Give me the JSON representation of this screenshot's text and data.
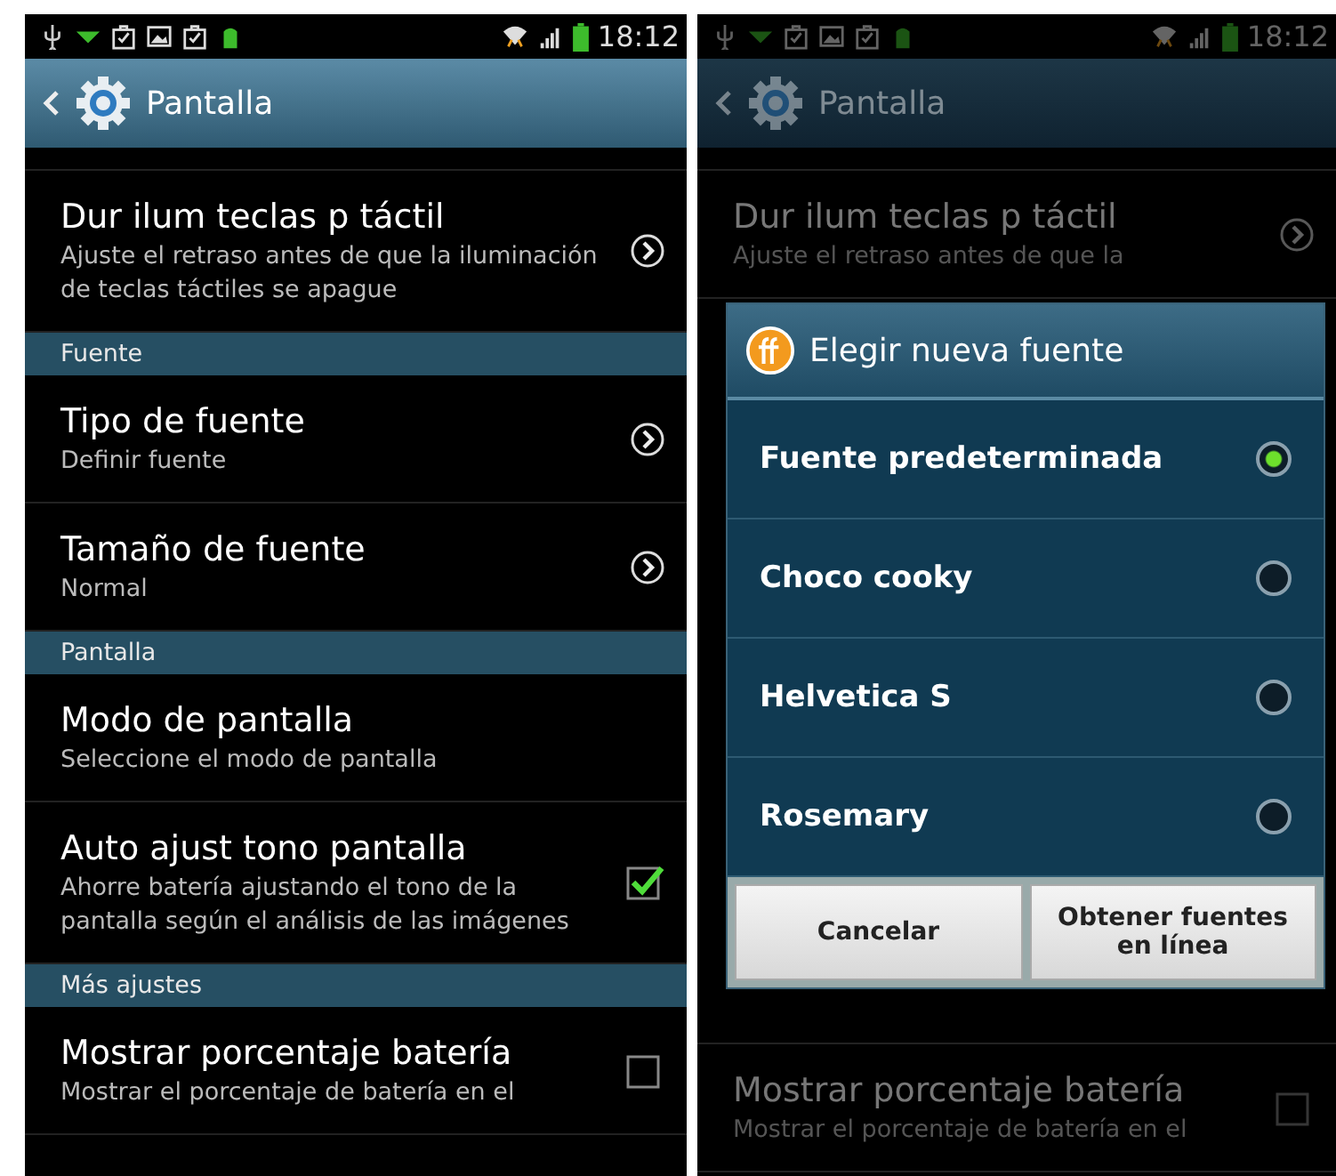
{
  "screens": [
    {
      "dimmed": false,
      "status_bar": {
        "time": "18:12"
      },
      "header": {
        "title": "Pantalla"
      },
      "items_above": [
        {
          "kind": "chevron",
          "title": "Dur ilum teclas p táctil",
          "subtitle": "Ajuste el retraso antes de que la iluminación de teclas táctiles se apague"
        },
        {
          "kind": "section",
          "title": "Fuente"
        },
        {
          "kind": "chevron",
          "title": "Tipo de fuente",
          "subtitle": "Definir fuente"
        },
        {
          "kind": "chevron",
          "title": "Tamaño de fuente",
          "subtitle": "Normal"
        },
        {
          "kind": "section",
          "title": "Pantalla"
        },
        {
          "kind": "plain",
          "title": "Modo de pantalla",
          "subtitle": "Seleccione el modo de pantalla"
        },
        {
          "kind": "checkbox",
          "title": "Auto ajust tono pantalla",
          "subtitle": "Ahorre batería ajustando el tono de la pantalla según el análisis de las imágenes",
          "checked": true
        },
        {
          "kind": "section",
          "title": "Más ajustes"
        },
        {
          "kind": "checkbox",
          "title": "Mostrar porcentaje batería",
          "subtitle": "Mostrar el porcentaje de batería en el",
          "checked": false
        }
      ]
    },
    {
      "dimmed": true,
      "status_bar": {
        "time": "18:12"
      },
      "header": {
        "title": "Pantalla"
      },
      "items_above": [
        {
          "kind": "chevron",
          "title": "Dur ilum teclas p táctil",
          "subtitle": "Ajuste el retraso antes de que la"
        }
      ],
      "dialog": {
        "title": "Elegir nueva fuente",
        "options": [
          {
            "label": "Fuente predeterminada",
            "selected": true
          },
          {
            "label": "Choco cooky",
            "selected": false
          },
          {
            "label": "Helvetica S",
            "selected": false
          },
          {
            "label": "Rosemary",
            "selected": false
          }
        ],
        "buttons": [
          "Cancelar",
          "Obtener fuentes en línea"
        ]
      },
      "items_below": [
        {
          "kind": "checkbox",
          "title": "Mostrar porcentaje batería",
          "subtitle": "Mostrar el porcentaje de batería en el",
          "checked": false
        }
      ]
    }
  ]
}
